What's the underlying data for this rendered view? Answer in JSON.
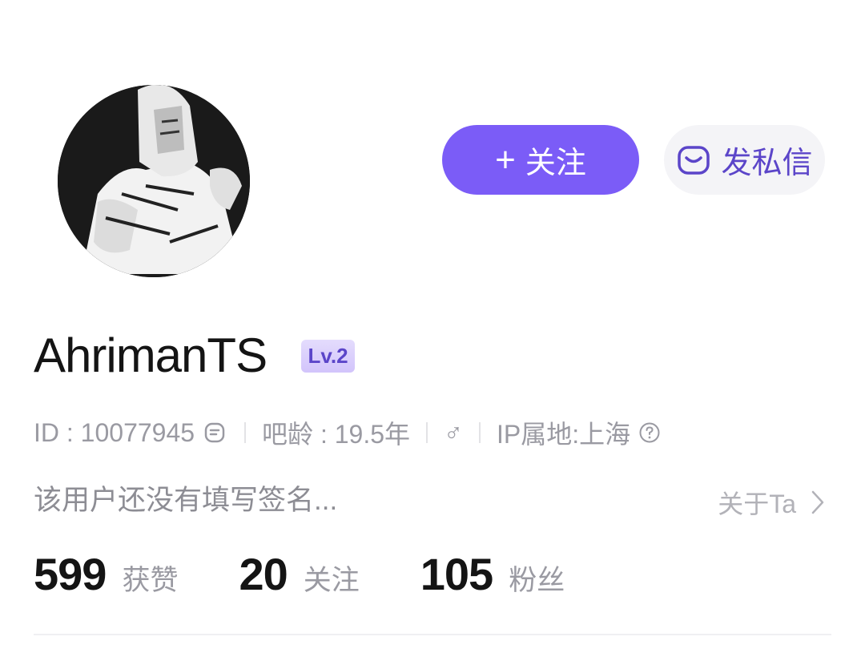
{
  "profile": {
    "follow_label": "关注",
    "message_label": "发私信",
    "username": "AhrimanTS",
    "level": "Lv.2",
    "id_text": "ID : 10077945",
    "age_text": "吧龄 : 19.5年",
    "gender_symbol": "♂",
    "ip_text": "IP属地:上海",
    "signature": "该用户还没有填写签名...",
    "about_label": "关于Ta"
  },
  "stats": [
    {
      "value": "599",
      "label": "获赞"
    },
    {
      "value": "20",
      "label": "关注"
    },
    {
      "value": "105",
      "label": "粉丝"
    }
  ],
  "colors": {
    "accent": "#7b5cf7",
    "accent_dark": "#5b45c9",
    "muted_text": "#9a9aa2"
  }
}
